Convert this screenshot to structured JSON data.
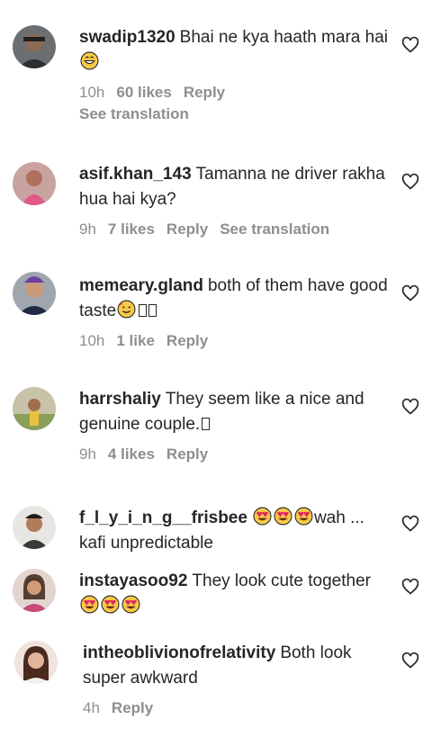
{
  "comments": [
    {
      "user": "swadip1320",
      "text": "Bhai ne kya haath mara hai",
      "emoji": "😄",
      "time": "10h",
      "likes": "60 likes",
      "reply": "Reply",
      "translation": "See translation"
    },
    {
      "user": "asif.khan_143",
      "text": "Tamanna ne driver rakha hua hai kya?",
      "time": "9h",
      "likes": "7 likes",
      "reply": "Reply",
      "translation": "See translation"
    },
    {
      "user": "memeary.gland",
      "text": "both of them have good taste",
      "emoji": "🥰",
      "time": "10h",
      "likes": "1 like",
      "reply": "Reply"
    },
    {
      "user": "harrshaliy",
      "text": "They seem like a nice and genuine couple.",
      "time": "9h",
      "likes": "4 likes",
      "reply": "Reply"
    },
    {
      "user": "f_l_y_i_n_g__frisbee",
      "text_before": "",
      "emoji": "😍",
      "text": "wah ... kafi unpredictable"
    },
    {
      "user": "instayasoo92",
      "text": "They look cute together",
      "emoji": "😍"
    },
    {
      "user": "intheoblivionofrelativity",
      "text": "Both look super awkward",
      "time": "4h",
      "reply": "Reply"
    }
  ],
  "icons": {
    "like": "heart-outline-icon"
  },
  "colors": {
    "text": "#262626",
    "meta": "#8e8e8e",
    "background": "#ffffff"
  }
}
